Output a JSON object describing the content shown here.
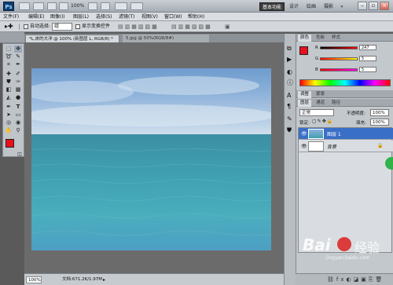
{
  "app": {
    "logo": "Ps",
    "zoom": "100%"
  },
  "workspaces": [
    "基本功能",
    "设计",
    "绘画",
    "摄影"
  ],
  "window_controls": {
    "minimize": "–",
    "restore": "▫",
    "close": "×"
  },
  "menu": [
    "文件(F)",
    "编辑(E)",
    "图像(I)",
    "图层(L)",
    "选择(S)",
    "滤镜(T)",
    "视图(V)",
    "窗口(W)",
    "帮助(H)"
  ],
  "options_bar": {
    "auto_select_label": "自动选择:",
    "auto_select_value": "组",
    "show_transform_label": "显示变换控件"
  },
  "documents": {
    "active_tab": "*L,岸的大洋 @ 100% (新图层 L, RGB/8) *",
    "inactive_tab": "5.jpg @ 50%(RGB/8#)"
  },
  "status": {
    "zoom": "100%",
    "doc_size": "文档:671.2K/1.97M"
  },
  "color_panel": {
    "tabs": [
      "颜色",
      "色板",
      "样式"
    ],
    "r_label": "R",
    "g_label": "G",
    "b_label": "B",
    "r_value": "247",
    "g_value": "5",
    "b_value": "5",
    "foreground": "#e8111b"
  },
  "layers_panel": {
    "top_tabs": [
      "调整",
      "蒙版"
    ],
    "tabs": [
      "图层",
      "通道",
      "路径"
    ],
    "blend_mode": "正常",
    "opacity_label": "不透明度:",
    "opacity_value": "100%",
    "lock_label": "锁定:",
    "fill_label": "填充:",
    "fill_value": "100%",
    "layers": [
      {
        "name": "图层 1",
        "selected": true
      },
      {
        "name": "背景",
        "selected": false
      }
    ]
  },
  "watermark": {
    "brand": "Bai",
    "suffix": "经验",
    "url": "jingyan.baidu.com"
  }
}
